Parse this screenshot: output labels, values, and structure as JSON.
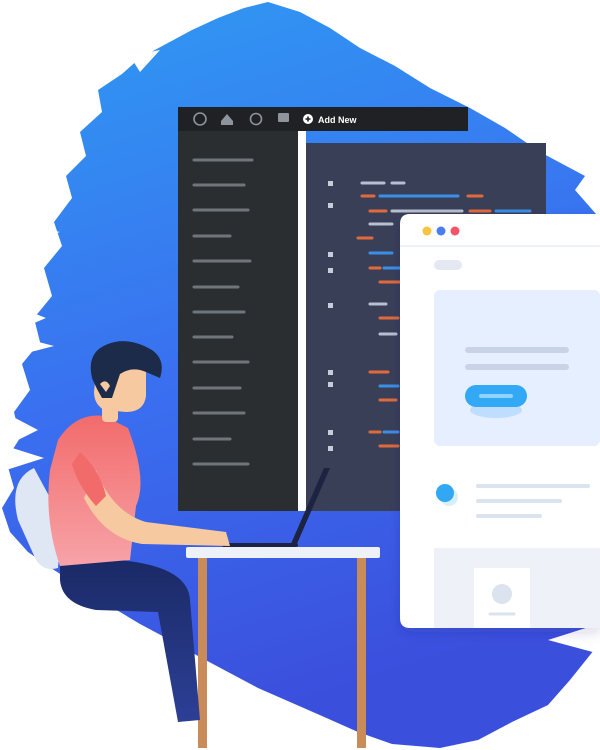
{
  "admin_bar": {
    "add_new_label": "Add New",
    "icons": [
      "wordpress-logo-icon",
      "home-icon",
      "customize-icon",
      "comments-icon",
      "plus-circle-icon"
    ]
  },
  "colors": {
    "brush_top": "#2f8cf0",
    "brush_bottom": "#3a4fe0",
    "admin_bar": "#1f2124",
    "sidebar": "#2b2e31",
    "editor": "#3a3f58",
    "code_orange": "#e06a3c",
    "code_blue": "#3c8fe6",
    "code_gray": "#b7bfd0",
    "browser_dot_yellow": "#f6c343",
    "browser_dot_blue": "#4d7cf0",
    "browser_dot_red": "#f0566a",
    "cta_button": "#33a8f5",
    "shirt": "#f26b6b",
    "hair": "#1d2b4a",
    "skin": "#f7c9a1"
  }
}
